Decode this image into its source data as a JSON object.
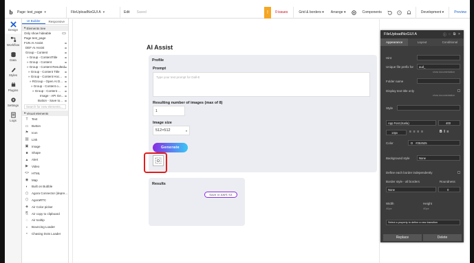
{
  "topbar": {
    "page_label": "Page: test_page",
    "element_label": "FileUploadNoGUI A",
    "edit": "Edit",
    "saved": "Saved",
    "issues": "0 issues",
    "grid": "Grid & borders",
    "arrange": "Arrange",
    "components": "Components",
    "development": "Development",
    "preview": "Preview"
  },
  "rail": [
    {
      "label": "Design",
      "icon": "design-icon"
    },
    {
      "label": "Workflow",
      "icon": "workflow-icon"
    },
    {
      "label": "Data",
      "icon": "data-icon"
    },
    {
      "label": "Styles",
      "icon": "styles-icon"
    },
    {
      "label": "Plugins",
      "icon": "plugins-icon"
    },
    {
      "label": "Settings",
      "icon": "settings-icon"
    },
    {
      "label": "Logs",
      "icon": "logs-icon"
    }
  ],
  "panel": {
    "tabs": [
      "UI Builder",
      "Responsive"
    ],
    "tree_header": "Elements tree",
    "only_hideable": "Only show hideable",
    "tree": [
      "Page test_page",
      "FUN AI Assist",
      "DEF AI Assist",
      "Group - Content",
      "» Group - ContentTitle",
      "» Group - Content",
      "» Group - Content Resulted",
      "» Group - Content Title",
      "» Group - Content Hoc...",
      "» RGroup - Open AI D...",
      "» Group - Content o...",
      "» Group - Content ...",
      "Image - API Ge...",
      "Button - Save to..."
    ],
    "search_placeholder": "Search for new elements...",
    "visual_header": "Visual elements",
    "visual": [
      {
        "label": "Text",
        "icon": "T"
      },
      {
        "label": "Button",
        "icon": "▭"
      },
      {
        "label": "Icon",
        "icon": "⚑"
      },
      {
        "label": "Link",
        "icon": "⛓"
      },
      {
        "label": "Image",
        "icon": "▣"
      },
      {
        "label": "Shape",
        "icon": "■"
      },
      {
        "label": "Alert",
        "icon": "▲"
      },
      {
        "label": "Video",
        "icon": "▶"
      },
      {
        "label": "HTML",
        "icon": "<>"
      },
      {
        "label": "Map",
        "icon": "◉"
      },
      {
        "label": "Built on Bubble",
        "icon": "◐"
      },
      {
        "label": "Agora Connector (depre...",
        "icon": "⬡"
      },
      {
        "label": "AgoraRTC",
        "icon": "⬡"
      },
      {
        "label": "Air Color picker",
        "icon": "◈"
      },
      {
        "label": "Air copy to clipboard",
        "icon": "⎘"
      },
      {
        "label": "Air tooltip",
        "icon": "◌"
      },
      {
        "label": "Bouncing Loader",
        "icon": "∘"
      },
      {
        "label": "Chasing Dots Loader",
        "icon": "∘"
      }
    ]
  },
  "main": {
    "title": "AI Assist",
    "profile_title": "Profile",
    "prompt_label": "Prompt",
    "prompt_placeholder": "Type your text prompt for Dall-E",
    "num_label": "Resulting number of images (max of 8)",
    "num_value": "1",
    "size_label": "Image size",
    "size_value": "512×512",
    "generate": "Generate",
    "results_title": "Results",
    "save_button": "Save in AWS S3"
  },
  "props": {
    "title": "FileUploadNoGUI A",
    "tabs": [
      "Appearance",
      "Layout",
      "Conditional"
    ],
    "hint_label": "Hint",
    "prefix_label": "Unique file prefix for",
    "prefix_value": "aud_",
    "show_doc": "show documentation",
    "folder_label": "Folder name",
    "display_title_label": "Display text title only",
    "style_label": "Style",
    "font": "App Font (Karla)",
    "weight": "400",
    "size": "14px",
    "color_label": "Color",
    "color_value": "#252525",
    "bg_label": "Background style",
    "bg_value": "None",
    "border_each": "Define each border independently",
    "border_style_label": "Border style - all borders",
    "roundness_label": "Roundness",
    "border_value": "None",
    "roundness_value": "0",
    "width_label": "Width",
    "width_value": "40px",
    "height_label": "Height",
    "height_value": "40px",
    "transition": "Select a property to define a new transition",
    "replace": "Replace",
    "delete": "Delete"
  }
}
